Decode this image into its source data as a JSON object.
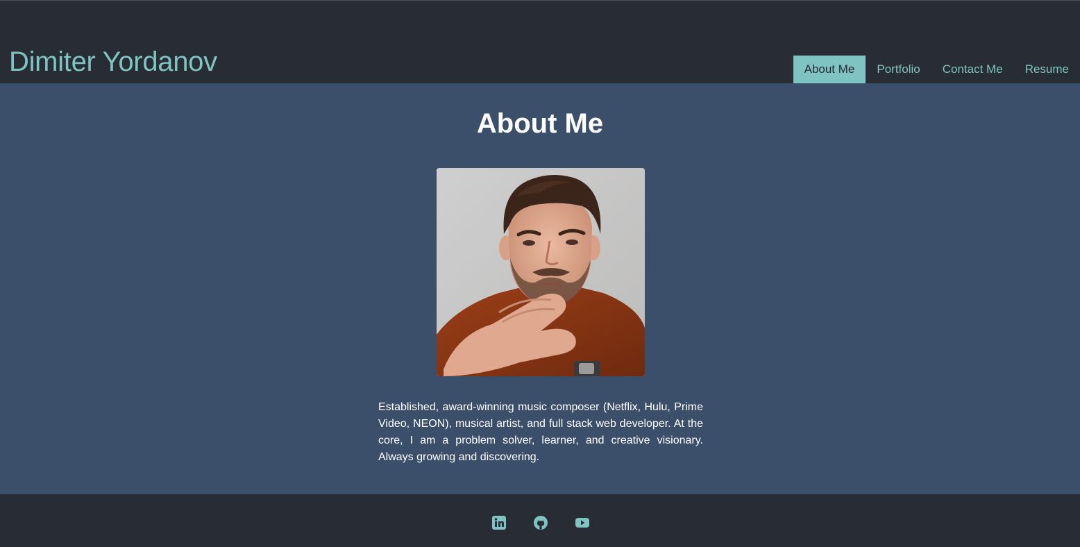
{
  "brand": {
    "name": "Dimiter Yordanov"
  },
  "nav": {
    "items": [
      {
        "label": "About Me",
        "active": true
      },
      {
        "label": "Portfolio",
        "active": false
      },
      {
        "label": "Contact Me",
        "active": false
      },
      {
        "label": "Resume",
        "active": false
      }
    ]
  },
  "about": {
    "title": "About Me",
    "bio": "Established, award-winning music composer (Netflix, Hulu, Prime Video, NEON), musical artist, and full stack web developer. At the core, I am a problem solver, learner, and creative visionary. Always growing and discovering."
  },
  "footer": {
    "social": [
      {
        "icon": "linkedin-icon"
      },
      {
        "icon": "github-icon"
      },
      {
        "icon": "youtube-icon"
      }
    ]
  },
  "colors": {
    "header_bg": "#282c35",
    "main_bg": "#3b4f6b",
    "accent": "#7fc3c2",
    "text": "#ffffff"
  }
}
